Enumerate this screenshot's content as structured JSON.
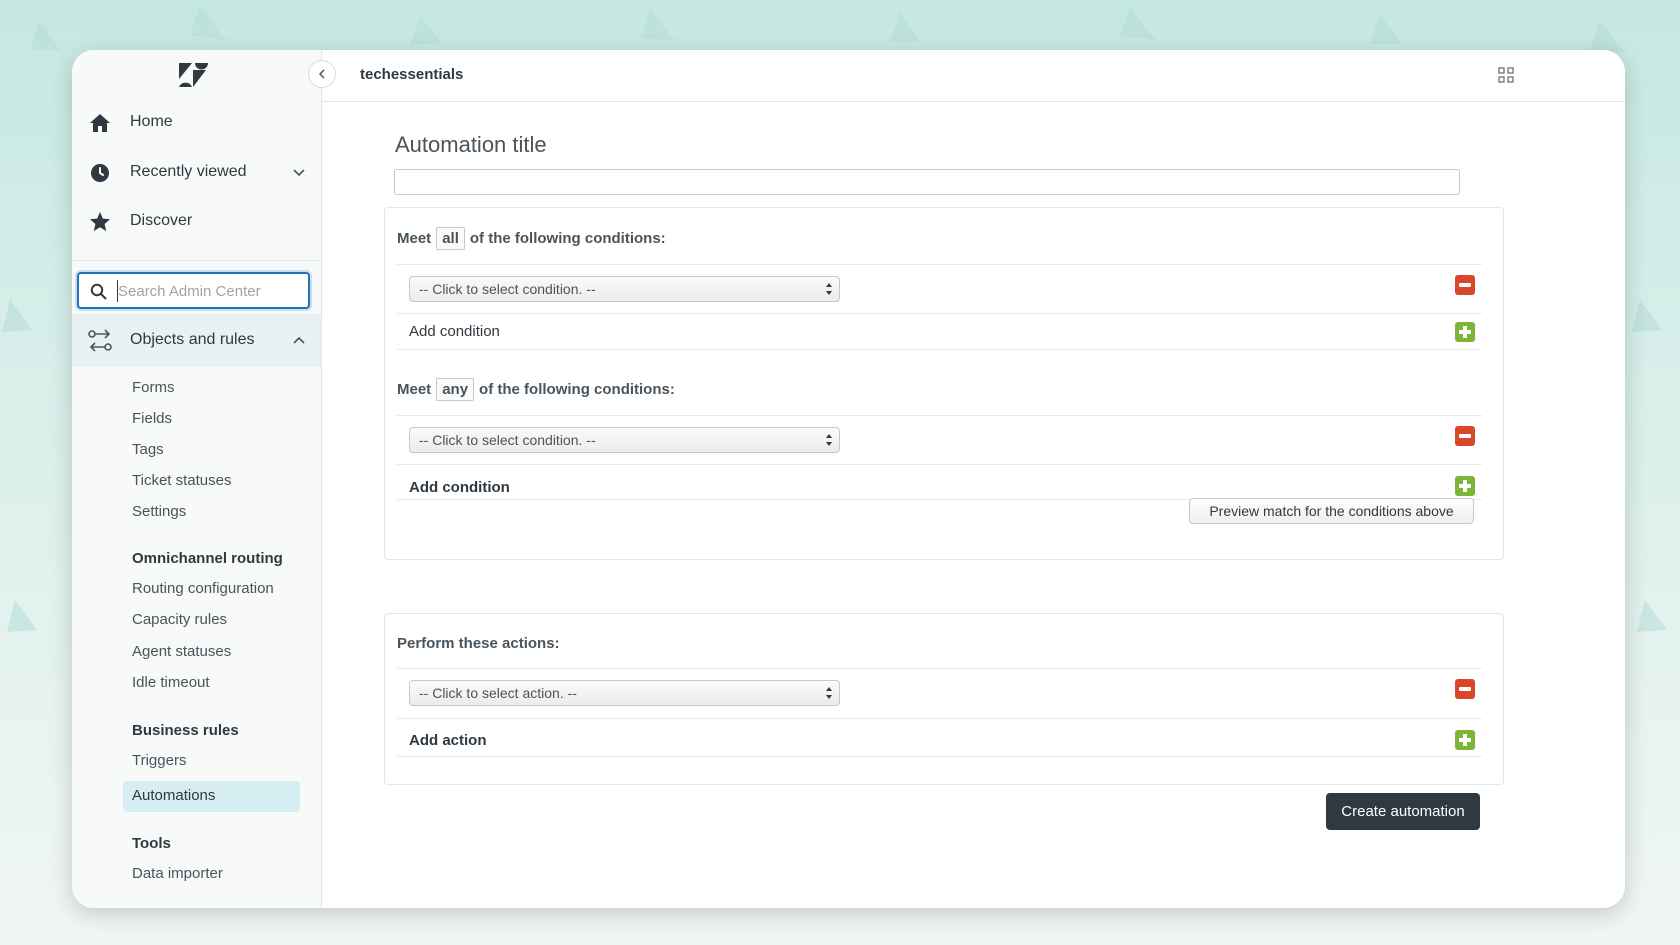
{
  "header": {
    "account_name": "techessentials"
  },
  "sidebar": {
    "nav": [
      {
        "label": "Home"
      },
      {
        "label": "Recently viewed"
      },
      {
        "label": "Discover"
      }
    ],
    "search_placeholder": "Search Admin Center",
    "group": {
      "label": "Objects and rules",
      "items": [
        "Forms",
        "Fields",
        "Tags",
        "Ticket statuses",
        "Settings"
      ]
    },
    "omnichannel": {
      "heading": "Omnichannel routing",
      "items": [
        "Routing configuration",
        "Capacity rules",
        "Agent statuses",
        "Idle timeout"
      ]
    },
    "business_rules": {
      "heading": "Business rules",
      "items": [
        "Triggers",
        "Automations"
      ],
      "active": "Automations"
    },
    "tools": {
      "heading": "Tools",
      "items": [
        "Data importer"
      ]
    }
  },
  "main": {
    "title": "Automation title",
    "title_value": "",
    "all_conditions": {
      "meet_prefix": "Meet",
      "match": "all",
      "meet_suffix": "of the following conditions:",
      "select_value": "-- Click to select condition. --",
      "add_label": "Add condition"
    },
    "any_conditions": {
      "meet_prefix": "Meet",
      "match": "any",
      "meet_suffix": "of the following conditions:",
      "select_value": "-- Click to select condition. --",
      "add_label": "Add condition"
    },
    "preview_button": "Preview match for the conditions above",
    "actions": {
      "heading": "Perform these actions:",
      "select_value": "-- Click to select action. --",
      "add_label": "Add action"
    },
    "create_button": "Create automation"
  },
  "colors": {
    "primary_blue": "#1f73b7",
    "remove_red": "#d9472b",
    "add_green": "#7bb63a",
    "dark_button": "#2f3941",
    "active_nav": "#d6eef1"
  }
}
